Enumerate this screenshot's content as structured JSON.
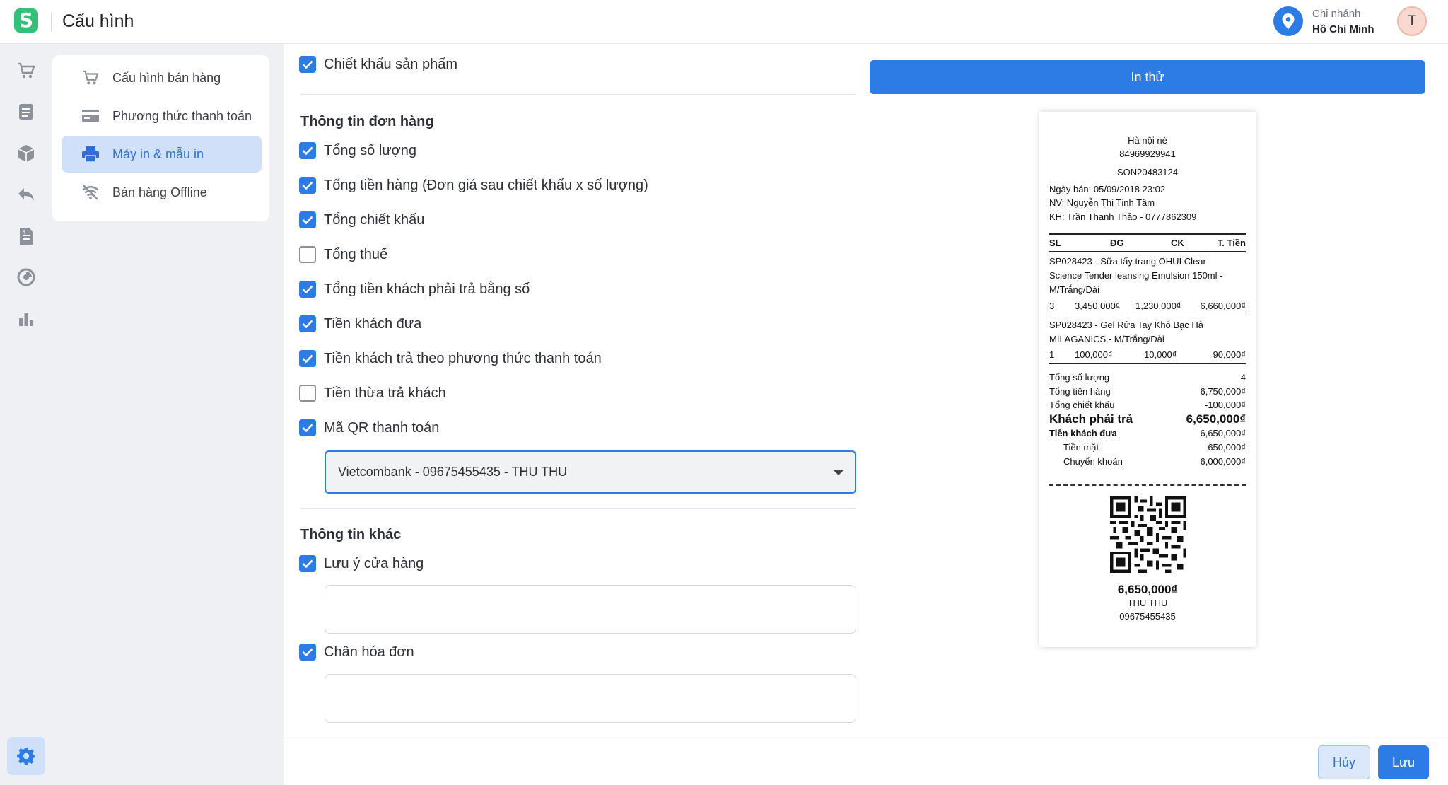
{
  "header": {
    "logo": "S",
    "title": "Cấu hình",
    "branch_label": "Chi nhánh",
    "branch_name": "Hồ Chí Minh",
    "avatar": "T"
  },
  "rail": {
    "icons": [
      "cart-icon",
      "invoice-icon",
      "box-icon",
      "return-icon",
      "receipt-icon",
      "pie-icon",
      "chart-icon"
    ],
    "settings": "gear-icon"
  },
  "submenu": {
    "items": [
      {
        "label": "Cấu hình bán hàng",
        "icon": "cart-icon"
      },
      {
        "label": "Phương thức thanh toán",
        "icon": "card-icon"
      },
      {
        "label": "Máy in & mẫu in",
        "icon": "printer-icon"
      },
      {
        "label": "Bán hàng Offline",
        "icon": "wifi-off-icon"
      }
    ],
    "active_index": 2
  },
  "form": {
    "product_discount": {
      "label": "Chiết khấu sản phẩm",
      "checked": true
    },
    "order_section": "Thông tin đơn hàng",
    "order_options": [
      {
        "label": "Tổng số lượng",
        "checked": true
      },
      {
        "label": "Tổng tiền hàng (Đơn giá sau chiết khấu x số lượng)",
        "checked": true
      },
      {
        "label": "Tổng chiết khấu",
        "checked": true
      },
      {
        "label": "Tổng thuế",
        "checked": false
      },
      {
        "label": "Tổng tiền khách phải trả bằng số",
        "checked": true
      },
      {
        "label": "Tiền khách đưa",
        "checked": true
      },
      {
        "label": "Tiền khách trả theo phương thức thanh toán",
        "checked": true
      },
      {
        "label": "Tiền thừa trả khách",
        "checked": false
      },
      {
        "label": "Mã QR thanh toán",
        "checked": true
      }
    ],
    "qr_account": "Vietcombank - 09675455435 - THU THU",
    "other_section": "Thông tin khác",
    "store_note": {
      "label": "Lưu ý cửa hàng",
      "checked": true,
      "value": ""
    },
    "footer_note": {
      "label": "Chân hóa đơn",
      "checked": true,
      "value": ""
    }
  },
  "preview": {
    "print_button": "In thử",
    "receipt": {
      "store": "Hà nội nè",
      "phone": "84969929941",
      "code": "SON20483124",
      "date": "Ngày bán: 05/09/2018 23:02",
      "staff": "NV: Nguyễn Thị Tịnh Tâm",
      "customer": "KH: Trần Thanh Thảo - 0777862309",
      "columns": [
        "SL",
        "ĐG",
        "CK",
        "T. Tiền"
      ],
      "items": [
        {
          "name_lines": [
            "SP028423 - Sữa tẩy trang OHUI Clear",
            "Science Tender leansing Emulsion 150ml -",
            "M/Trắng/Dài"
          ],
          "qty": "3",
          "price": "3,450,000₫",
          "discount": "1,230,000₫",
          "total": "6,660,000₫"
        },
        {
          "name_lines": [
            "SP028423 - Gel Rửa Tay Khô Bạc Hà",
            "MILAGANICS - M/Trắng/Dài"
          ],
          "qty": "1",
          "price": "100,000₫",
          "discount": "10,000₫",
          "total": "90,000₫"
        }
      ],
      "summary": [
        {
          "label": "Tổng số lượng",
          "value": "4"
        },
        {
          "label": "Tổng tiền hàng",
          "value": "6,750,000₫"
        },
        {
          "label": "Tổng chiết khấu",
          "value": "-100,000₫"
        },
        {
          "label": "Khách phải trả",
          "value": "6,650,000₫"
        },
        {
          "label": "Tiền khách đưa",
          "value": "6,650,000₫"
        },
        {
          "label": "Tiền mặt",
          "value": "650,000₫"
        },
        {
          "label": "Chuyển khoản",
          "value": "6,000,000₫"
        }
      ],
      "qr_amount": "6,650,000₫",
      "qr_name": "THU THU",
      "qr_account": "09675455435"
    }
  },
  "footer": {
    "cancel": "Hủy",
    "save": "Lưu"
  }
}
